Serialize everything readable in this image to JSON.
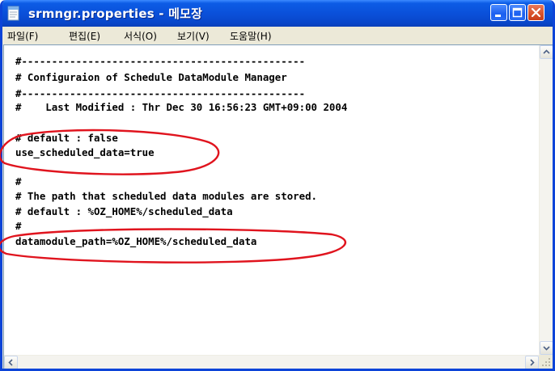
{
  "window": {
    "title": "srmngr.properties - 메모장",
    "accent": "#0a4fd8",
    "controls": [
      "minimize",
      "maximize",
      "close"
    ]
  },
  "menu": [
    {
      "label": "파일(F)"
    },
    {
      "label": "편집(E)"
    },
    {
      "label": "서식(O)"
    },
    {
      "label": "보기(V)"
    },
    {
      "label": "도움말(H)"
    }
  ],
  "editor": {
    "lines": [
      "#-----------------------------------------------",
      "# Configuraion of Schedule DataModule Manager",
      "#-----------------------------------------------",
      "#    Last Modified : Thr Dec 30 16:56:23 GMT+09:00 2004",
      "",
      "# default : false",
      "use_scheduled_data=true",
      "",
      "#",
      "# The path that scheduled data modules are stored.",
      "# default : %OZ_HOME%/scheduled_data",
      "#",
      "datamodule_path=%OZ_HOME%/scheduled_data"
    ]
  },
  "annotations": {
    "highlight_color": "#e0141e",
    "highlighted_lines": [
      "use_scheduled_data=true",
      "datamodule_path=%OZ_HOME%/scheduled_data"
    ]
  }
}
